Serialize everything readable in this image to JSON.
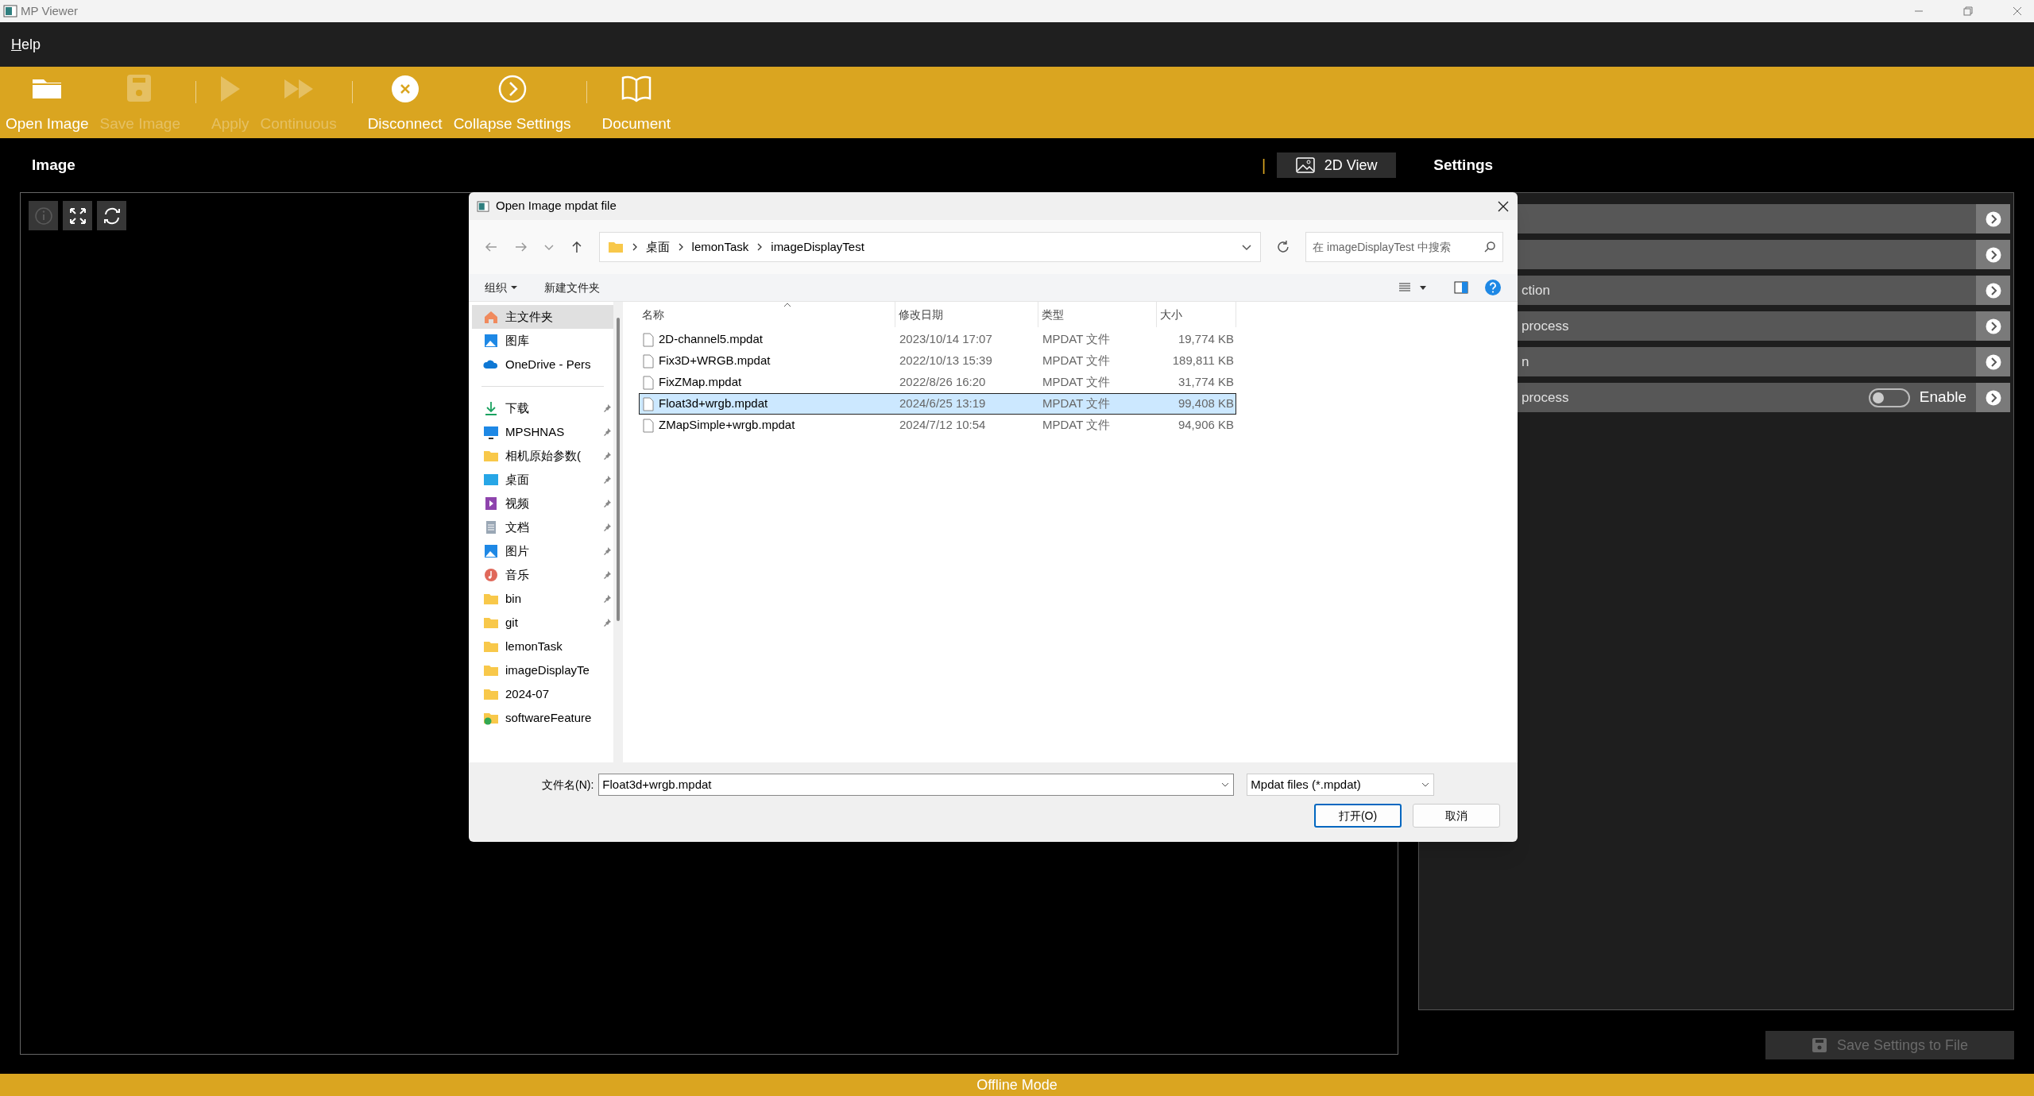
{
  "window": {
    "title": "MP Viewer"
  },
  "menu": [
    {
      "label": "Help"
    }
  ],
  "toolbar": {
    "groups": [
      [
        {
          "kind": "folder",
          "label": "Open Image",
          "disabled": false
        },
        {
          "kind": "save",
          "label": "Save Image",
          "disabled": true
        }
      ],
      [
        {
          "kind": "play",
          "label": "Apply",
          "disabled": true
        },
        {
          "kind": "forward",
          "label": "Continuous",
          "disabled": true
        }
      ],
      [
        {
          "kind": "disconnect",
          "label": "Disconnect",
          "disabled": false
        },
        {
          "kind": "collapse",
          "label": "Collapse Settings",
          "disabled": false
        }
      ],
      [
        {
          "kind": "book",
          "label": "Document",
          "disabled": false
        }
      ]
    ]
  },
  "image_panel": {
    "title": "Image",
    "tools": [
      {
        "kind": "info",
        "disabled": true
      },
      {
        "kind": "expand",
        "disabled": false
      },
      {
        "kind": "refresh",
        "disabled": false
      }
    ]
  },
  "view_divider": "|",
  "view_button": {
    "label": "2D View"
  },
  "settings": {
    "title": "Settings",
    "rows": [
      {},
      {},
      {
        "label": "ction"
      },
      {
        "label": "process"
      },
      {
        "label": "n"
      },
      {
        "label": "process",
        "toggle": {
          "on": false,
          "label": "Enable"
        }
      }
    ],
    "save_button": {
      "label": "Save Settings to File",
      "disabled": true
    }
  },
  "dialog": {
    "title": "Open Image mpdat file",
    "breadcrumb": [
      "桌面",
      "lemonTask",
      "imageDisplayTest"
    ],
    "search": {
      "placeholder": "在 imageDisplayTest 中搜索"
    },
    "commands": [
      "组织",
      "新建文件夹"
    ],
    "sidebar": {
      "sections": [
        [
          {
            "kind": "home",
            "label": "主文件夹",
            "selected": true,
            "pinned": false
          },
          {
            "kind": "gallery",
            "label": "图库",
            "selected": false,
            "pinned": false
          },
          {
            "kind": "cloud",
            "label": "OneDrive - Pers",
            "selected": false,
            "pinned": false
          }
        ],
        [
          {
            "kind": "download",
            "label": "下载",
            "selected": false,
            "pinned": true
          },
          {
            "kind": "drive",
            "label": "MPSHNAS",
            "selected": false,
            "pinned": true
          },
          {
            "kind": "folder",
            "label": "相机原始参数(",
            "selected": false,
            "pinned": true
          },
          {
            "kind": "desktop",
            "label": "桌面",
            "selected": false,
            "pinned": true
          },
          {
            "kind": "video",
            "label": "视频",
            "selected": false,
            "pinned": true
          },
          {
            "kind": "docs",
            "label": "文档",
            "selected": false,
            "pinned": true
          },
          {
            "kind": "pictures",
            "label": "图片",
            "selected": false,
            "pinned": true
          },
          {
            "kind": "music",
            "label": "音乐",
            "selected": false,
            "pinned": true
          },
          {
            "kind": "folder",
            "label": "bin",
            "selected": false,
            "pinned": true
          },
          {
            "kind": "folder",
            "label": "git",
            "selected": false,
            "pinned": true
          },
          {
            "kind": "folder",
            "label": "lemonTask",
            "selected": false,
            "pinned": false
          },
          {
            "kind": "folder",
            "label": "imageDisplayTe",
            "selected": false,
            "pinned": false
          },
          {
            "kind": "folder",
            "label": "2024-07",
            "selected": false,
            "pinned": false
          },
          {
            "kind": "shared",
            "label": "softwareFeature",
            "selected": false,
            "pinned": false
          }
        ]
      ]
    },
    "columns": [
      "名称",
      "修改日期",
      "类型",
      "大小"
    ],
    "files": [
      {
        "name": "2D-channel5.mpdat",
        "modified": "2023/10/14 17:07",
        "type": "MPDAT 文件",
        "size": "19,774 KB",
        "selected": false
      },
      {
        "name": "Fix3D+WRGB.mpdat",
        "modified": "2022/10/13 15:39",
        "type": "MPDAT 文件",
        "size": "189,811 KB",
        "selected": false
      },
      {
        "name": "FixZMap.mpdat",
        "modified": "2022/8/26 16:20",
        "type": "MPDAT 文件",
        "size": "31,774 KB",
        "selected": false
      },
      {
        "name": "Float3d+wrgb.mpdat",
        "modified": "2024/6/25 13:19",
        "type": "MPDAT 文件",
        "size": "99,408 KB",
        "selected": true
      },
      {
        "name": "ZMapSimple+wrgb.mpdat",
        "modified": "2024/7/12 10:54",
        "type": "MPDAT 文件",
        "size": "94,906 KB",
        "selected": false
      }
    ],
    "filename_label": "文件名(N):",
    "filename": "Float3d+wrgb.mpdat",
    "filter": "Mpdat files (*.mpdat)",
    "buttons": [
      {
        "label": "打开(O)",
        "primary": true
      },
      {
        "label": "取消",
        "primary": false
      }
    ]
  },
  "status_bar": "Offline Mode"
}
